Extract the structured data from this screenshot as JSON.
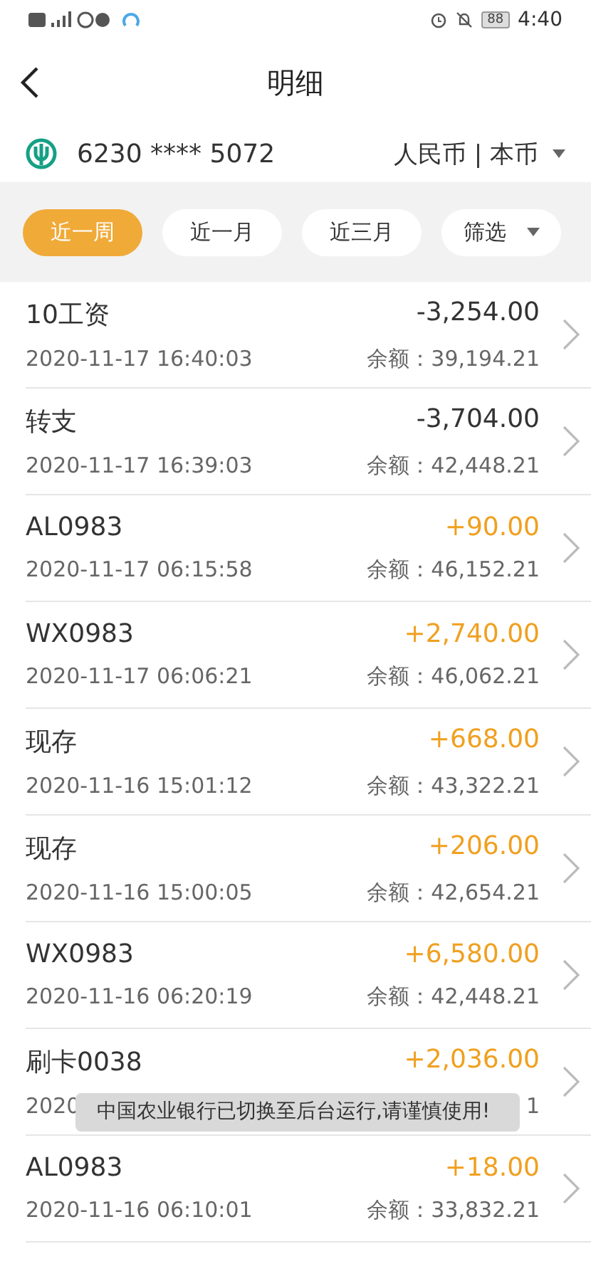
{
  "status_bar": {
    "time": "4:40",
    "battery": "88"
  },
  "header": {
    "title": "明细"
  },
  "account": {
    "number": "6230 **** 5072",
    "currency": "人民币 | 本币"
  },
  "filters": [
    {
      "label": "近一周",
      "selected": true,
      "kind": "period"
    },
    {
      "label": "近一月",
      "selected": false,
      "kind": "period"
    },
    {
      "label": "近三月",
      "selected": false,
      "kind": "period"
    },
    {
      "label": "筛选",
      "selected": false,
      "kind": "dropdown"
    }
  ],
  "transactions": [
    {
      "title": "10工资",
      "amount": "-3,254.00",
      "kind": "debit",
      "date": "2020-11-17 16:40:03",
      "balance": "余额：39,194.21"
    },
    {
      "title": "转支",
      "amount": "-3,704.00",
      "kind": "debit",
      "date": "2020-11-17 16:39:03",
      "balance": "余额：42,448.21"
    },
    {
      "title": "AL0983",
      "amount": "+90.00",
      "kind": "credit",
      "date": "2020-11-17 06:15:58",
      "balance": "余额：46,152.21"
    },
    {
      "title": "WX0983",
      "amount": "+2,740.00",
      "kind": "credit",
      "date": "2020-11-17 06:06:21",
      "balance": "余额：46,062.21"
    },
    {
      "title": "现存",
      "amount": "+668.00",
      "kind": "credit",
      "date": "2020-11-16 15:01:12",
      "balance": "余额：43,322.21"
    },
    {
      "title": "现存",
      "amount": "+206.00",
      "kind": "credit",
      "date": "2020-11-16 15:00:05",
      "balance": "余额：42,654.21"
    },
    {
      "title": "WX0983",
      "amount": "+6,580.00",
      "kind": "credit",
      "date": "2020-11-16 06:20:19",
      "balance": "余额：42,448.21"
    },
    {
      "title": "刷卡0038",
      "amount": "+2,036.00",
      "kind": "credit",
      "date": "2020",
      "balance": "1"
    },
    {
      "title": "AL0983",
      "amount": "+18.00",
      "kind": "credit",
      "date": "2020-11-16 06:10:01",
      "balance": "余额：33,832.21"
    }
  ],
  "toast": {
    "message": "中国农业银行已切换至后台运行,请谨慎使用!"
  }
}
